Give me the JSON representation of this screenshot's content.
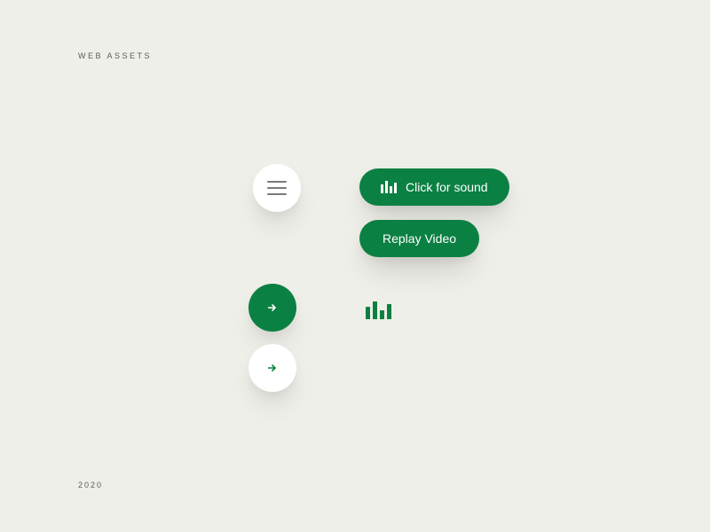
{
  "page": {
    "title": "WEB ASSETS",
    "footer": "2020"
  },
  "colors": {
    "accent": "#0b8043",
    "surface": "#ffffff",
    "background": "#efefe9"
  },
  "buttons": {
    "sound_label": "Click for sound",
    "replay_label": "Replay Video"
  },
  "icons": {
    "hamburger": "hamburger-icon",
    "arrow_right": "arrow-right-icon",
    "equalizer": "equalizer-icon"
  }
}
